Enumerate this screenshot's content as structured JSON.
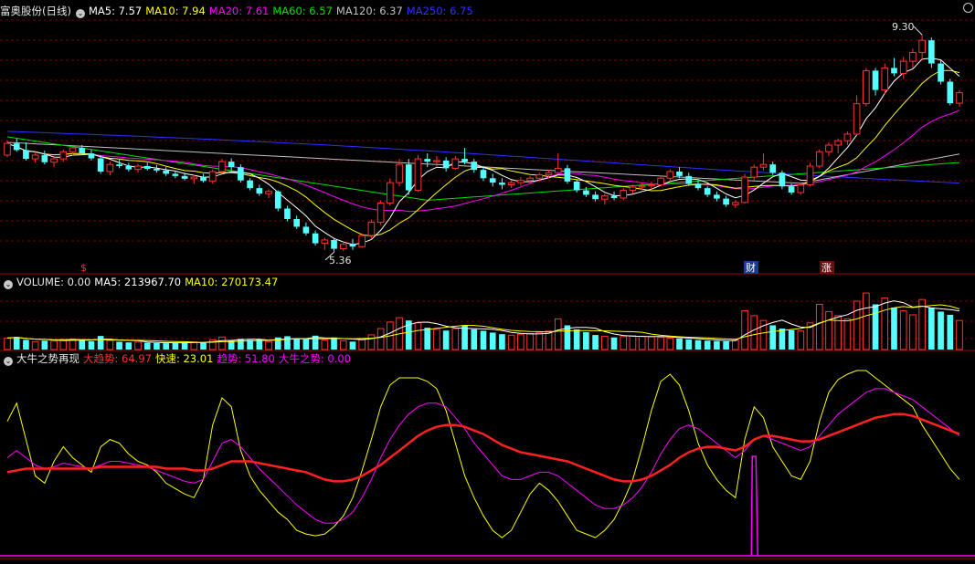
{
  "stock_name": "富奥股份(日线)",
  "ma_lines": [
    {
      "label": "MA5: 7.57",
      "color": "#ffffff"
    },
    {
      "label": "MA10: 7.94",
      "color": "#ffff00"
    },
    {
      "label": "MA20: 7.61",
      "color": "#ff00ff"
    },
    {
      "label": "MA60: 6.57",
      "color": "#00e000"
    },
    {
      "label": "MA120: 6.37",
      "color": "#c0c0c0"
    },
    {
      "label": "MA250: 6.75",
      "color": "#3030ff"
    }
  ],
  "price_annotations": {
    "high": "9.30",
    "low": "5.36"
  },
  "event_markers": [
    {
      "label": "$",
      "type": "dividend",
      "color": "#ff3030"
    },
    {
      "label": "财",
      "type": "finance",
      "color": "#4a7aff"
    },
    {
      "label": "涨",
      "type": "limit-up",
      "color": "#ff3030"
    }
  ],
  "volume_panel": {
    "title": "VOLUME: 0.00",
    "ma5": "MA5: 213967.70",
    "ma10": "MA10: 270173.47"
  },
  "indicator_panel": {
    "title": "大牛之势再现",
    "big_trend": "大趋势: 64.97",
    "fast": "快速: 23.01",
    "trend": "趋势: 51.80",
    "bull": "大牛之势: 0.00"
  },
  "colors": {
    "up": "#ff3232",
    "down": "#54ffff",
    "grid": "#7a0000",
    "ma5": "#ffffff",
    "ma10": "#ffff00",
    "ma20": "#ff00ff",
    "ma60": "#00e000",
    "ma120": "#c0c0c0",
    "ma250": "#3030ff"
  },
  "chart_data": {
    "type": "candlestick",
    "price_axis": {
      "ylim": [
        5.0,
        9.6
      ]
    },
    "candles_ohlc": [
      [
        7.12,
        7.38,
        7.08,
        7.33
      ],
      [
        7.33,
        7.42,
        7.18,
        7.21
      ],
      [
        7.21,
        7.35,
        7.02,
        7.05
      ],
      [
        7.05,
        7.18,
        6.98,
        7.12
      ],
      [
        7.12,
        7.2,
        6.95,
        6.99
      ],
      [
        6.99,
        7.1,
        6.9,
        7.05
      ],
      [
        7.05,
        7.22,
        7.0,
        7.18
      ],
      [
        7.18,
        7.28,
        7.1,
        7.25
      ],
      [
        7.25,
        7.3,
        7.12,
        7.15
      ],
      [
        7.15,
        7.22,
        7.02,
        7.06
      ],
      [
        7.06,
        7.12,
        6.78,
        6.82
      ],
      [
        6.82,
        7.0,
        6.75,
        6.95
      ],
      [
        6.95,
        7.05,
        6.88,
        6.92
      ],
      [
        6.92,
        6.98,
        6.82,
        6.86
      ],
      [
        6.86,
        6.96,
        6.8,
        6.92
      ],
      [
        6.92,
        6.98,
        6.84,
        6.87
      ],
      [
        6.87,
        6.94,
        6.8,
        6.84
      ],
      [
        6.84,
        6.9,
        6.74,
        6.78
      ],
      [
        6.78,
        6.84,
        6.7,
        6.74
      ],
      [
        6.74,
        6.8,
        6.66,
        6.69
      ],
      [
        6.69,
        6.76,
        6.6,
        6.72
      ],
      [
        6.72,
        6.78,
        6.62,
        6.65
      ],
      [
        6.65,
        6.86,
        6.6,
        6.82
      ],
      [
        6.82,
        7.05,
        6.78,
        7.0
      ],
      [
        7.0,
        7.06,
        6.84,
        6.9
      ],
      [
        6.9,
        6.95,
        6.62,
        6.66
      ],
      [
        6.66,
        6.7,
        6.48,
        6.52
      ],
      [
        6.52,
        6.58,
        6.38,
        6.42
      ],
      [
        6.42,
        6.5,
        6.34,
        6.46
      ],
      [
        6.46,
        6.48,
        6.1,
        6.15
      ],
      [
        6.15,
        6.2,
        5.92,
        5.96
      ],
      [
        5.96,
        6.02,
        5.78,
        5.82
      ],
      [
        5.82,
        5.9,
        5.66,
        5.7
      ],
      [
        5.7,
        5.75,
        5.48,
        5.52
      ],
      [
        5.52,
        5.62,
        5.4,
        5.58
      ],
      [
        5.58,
        5.62,
        5.36,
        5.42
      ],
      [
        5.42,
        5.55,
        5.38,
        5.5
      ],
      [
        5.5,
        5.6,
        5.4,
        5.46
      ],
      [
        5.46,
        5.7,
        5.44,
        5.66
      ],
      [
        5.66,
        5.95,
        5.6,
        5.9
      ],
      [
        5.9,
        6.3,
        5.85,
        6.25
      ],
      [
        6.25,
        6.7,
        6.2,
        6.62
      ],
      [
        6.62,
        7.05,
        6.55,
        6.95
      ],
      [
        6.95,
        7.05,
        6.4,
        6.48
      ],
      [
        6.48,
        7.12,
        6.45,
        7.05
      ],
      [
        7.05,
        7.15,
        6.9,
        7.0
      ],
      [
        7.0,
        7.1,
        6.92,
        7.02
      ],
      [
        7.02,
        7.08,
        6.82,
        6.88
      ],
      [
        6.88,
        7.1,
        6.85,
        7.05
      ],
      [
        7.05,
        7.25,
        6.95,
        7.0
      ],
      [
        7.0,
        7.05,
        6.8,
        6.85
      ],
      [
        6.85,
        6.92,
        6.65,
        6.7
      ],
      [
        6.7,
        6.78,
        6.55,
        6.62
      ],
      [
        6.62,
        6.7,
        6.5,
        6.58
      ],
      [
        6.58,
        6.66,
        6.52,
        6.62
      ],
      [
        6.62,
        6.72,
        6.56,
        6.66
      ],
      [
        6.66,
        6.74,
        6.6,
        6.7
      ],
      [
        6.7,
        6.8,
        6.64,
        6.76
      ],
      [
        6.76,
        6.85,
        6.7,
        6.8
      ],
      [
        6.8,
        7.15,
        6.78,
        6.88
      ],
      [
        6.88,
        6.94,
        6.6,
        6.64
      ],
      [
        6.64,
        6.68,
        6.44,
        6.48
      ],
      [
        6.48,
        6.54,
        6.36,
        6.4
      ],
      [
        6.4,
        6.46,
        6.28,
        6.32
      ],
      [
        6.32,
        6.42,
        6.22,
        6.38
      ],
      [
        6.38,
        6.46,
        6.3,
        6.34
      ],
      [
        6.34,
        6.52,
        6.3,
        6.48
      ],
      [
        6.48,
        6.58,
        6.42,
        6.54
      ],
      [
        6.54,
        6.62,
        6.48,
        6.56
      ],
      [
        6.56,
        6.64,
        6.5,
        6.58
      ],
      [
        6.58,
        6.74,
        6.55,
        6.7
      ],
      [
        6.7,
        6.86,
        6.64,
        6.82
      ],
      [
        6.82,
        6.9,
        6.7,
        6.74
      ],
      [
        6.74,
        6.8,
        6.56,
        6.6
      ],
      [
        6.6,
        6.66,
        6.48,
        6.52
      ],
      [
        6.52,
        6.56,
        6.36,
        6.4
      ],
      [
        6.4,
        6.46,
        6.28,
        6.33
      ],
      [
        6.33,
        6.38,
        6.18,
        6.22
      ],
      [
        6.22,
        6.3,
        6.16,
        6.26
      ],
      [
        6.26,
        6.78,
        6.24,
        6.72
      ],
      [
        6.72,
        6.95,
        6.66,
        6.9
      ],
      [
        6.9,
        7.15,
        6.84,
        6.95
      ],
      [
        6.95,
        7.0,
        6.76,
        6.8
      ],
      [
        6.8,
        6.84,
        6.5,
        6.55
      ],
      [
        6.55,
        6.6,
        6.4,
        6.44
      ],
      [
        6.44,
        6.6,
        6.4,
        6.58
      ],
      [
        6.58,
        6.98,
        6.55,
        6.92
      ],
      [
        6.92,
        7.22,
        6.88,
        7.18
      ],
      [
        7.18,
        7.35,
        7.1,
        7.3
      ],
      [
        7.3,
        7.42,
        7.15,
        7.38
      ],
      [
        7.38,
        7.55,
        7.3,
        7.5
      ],
      [
        7.5,
        8.2,
        7.48,
        8.05
      ],
      [
        8.05,
        8.7,
        8.0,
        8.65
      ],
      [
        8.65,
        8.7,
        8.2,
        8.3
      ],
      [
        8.3,
        8.78,
        8.22,
        8.7
      ],
      [
        8.7,
        8.88,
        8.55,
        8.6
      ],
      [
        8.6,
        8.9,
        8.5,
        8.82
      ],
      [
        8.82,
        9.05,
        8.7,
        8.98
      ],
      [
        8.98,
        9.3,
        8.85,
        9.2
      ],
      [
        9.2,
        9.25,
        8.7,
        8.78
      ],
      [
        8.78,
        8.84,
        8.4,
        8.45
      ],
      [
        8.45,
        8.5,
        8.02,
        8.06
      ],
      [
        8.06,
        8.3,
        8.0,
        8.25
      ]
    ],
    "volume": [
      142000,
      156000,
      120000,
      98000,
      110000,
      105000,
      124000,
      132000,
      118000,
      102000,
      168000,
      112000,
      96000,
      88000,
      92000,
      84000,
      80000,
      78000,
      86000,
      90000,
      94000,
      88000,
      120000,
      155000,
      110000,
      132000,
      118000,
      126000,
      98000,
      150000,
      165000,
      140000,
      128000,
      172000,
      118000,
      150000,
      110000,
      98000,
      135000,
      182000,
      260000,
      340000,
      395000,
      360000,
      330000,
      270000,
      250000,
      235000,
      260000,
      300000,
      250000,
      232000,
      210000,
      190000,
      178000,
      190000,
      198000,
      212000,
      228000,
      380000,
      300000,
      250000,
      215000,
      180000,
      165000,
      150000,
      160000,
      172000,
      165000,
      158000,
      150000,
      142000,
      138000,
      125000,
      116000,
      110000,
      105000,
      102000,
      115000,
      480000,
      420000,
      360000,
      300000,
      260000,
      240000,
      230000,
      330000,
      560000,
      470000,
      420000,
      380000,
      600000,
      700000,
      560000,
      640000,
      520000,
      480000,
      430000,
      620000,
      520000,
      470000,
      430000,
      360000
    ],
    "fast_line": [
      72,
      82,
      62,
      42,
      38,
      50,
      58,
      52,
      48,
      44,
      58,
      62,
      60,
      54,
      50,
      48,
      44,
      38,
      35,
      32,
      30,
      40,
      70,
      85,
      80,
      56,
      42,
      34,
      28,
      22,
      18,
      12,
      10,
      9,
      10,
      14,
      20,
      30,
      45,
      62,
      80,
      92,
      96,
      96,
      96,
      94,
      90,
      78,
      60,
      42,
      30,
      20,
      12,
      8,
      12,
      22,
      32,
      38,
      34,
      28,
      20,
      12,
      10,
      8,
      12,
      18,
      28,
      40,
      58,
      78,
      94,
      98,
      92,
      78,
      60,
      48,
      40,
      34,
      30,
      62,
      80,
      74,
      58,
      50,
      42,
      40,
      50,
      72,
      88,
      95,
      98,
      100,
      100,
      96,
      92,
      88,
      84,
      80,
      70,
      62,
      54,
      46,
      40
    ],
    "ma_trend": [
      52,
      56,
      52,
      48,
      46,
      47,
      49,
      48,
      47,
      46,
      48,
      50,
      50,
      49,
      48,
      47,
      45,
      43,
      41,
      39,
      38,
      40,
      50,
      60,
      62,
      58,
      52,
      46,
      41,
      36,
      31,
      26,
      22,
      18,
      16,
      16,
      18,
      22,
      30,
      40,
      52,
      62,
      70,
      76,
      80,
      82,
      82,
      80,
      74,
      68,
      60,
      54,
      48,
      42,
      40,
      40,
      42,
      44,
      44,
      42,
      38,
      34,
      30,
      26,
      24,
      24,
      26,
      30,
      36,
      44,
      54,
      62,
      68,
      70,
      68,
      64,
      60,
      56,
      52,
      56,
      62,
      64,
      62,
      60,
      58,
      56,
      58,
      64,
      70,
      76,
      80,
      84,
      88,
      90,
      90,
      88,
      86,
      84,
      80,
      76,
      72,
      68,
      64
    ],
    "big_trend": [
      44,
      45,
      46,
      46,
      46,
      46,
      46,
      46,
      46,
      46,
      47,
      47,
      47,
      47,
      47,
      47,
      47,
      46,
      46,
      46,
      45,
      45,
      46,
      48,
      50,
      50,
      50,
      49,
      48,
      47,
      46,
      45,
      44,
      42,
      40,
      39,
      39,
      40,
      42,
      45,
      48,
      52,
      56,
      60,
      64,
      67,
      69,
      70,
      70,
      69,
      67,
      65,
      62,
      59,
      57,
      55,
      54,
      53,
      52,
      51,
      50,
      48,
      46,
      44,
      42,
      40,
      39,
      39,
      40,
      42,
      45,
      48,
      52,
      55,
      57,
      58,
      58,
      57,
      56,
      58,
      62,
      64,
      64,
      63,
      62,
      61,
      61,
      62,
      64,
      66,
      68,
      70,
      72,
      74,
      75,
      76,
      76,
      75,
      73,
      71,
      69,
      67,
      65
    ],
    "bull_spike_index": 80
  }
}
